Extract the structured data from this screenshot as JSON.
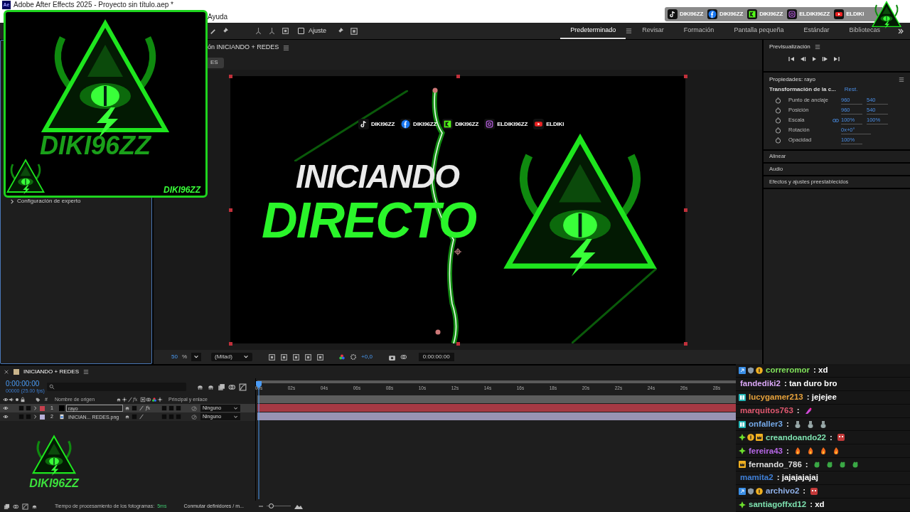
{
  "window": {
    "app_icon": "Ae",
    "title": "Adobe After Effects 2025 - Proyecto sin título.aep *"
  },
  "menu": [
    "Ayuda"
  ],
  "toolbar": {
    "snap": {
      "label": "Ajuste",
      "checked": false
    }
  },
  "workspaces": [
    {
      "label": "Predeterminado",
      "selected": true
    },
    {
      "label": "Revisar",
      "selected": false
    },
    {
      "label": "Formación",
      "selected": false
    },
    {
      "label": "Pantalla pequeña",
      "selected": false
    },
    {
      "label": "Estándar",
      "selected": false
    },
    {
      "label": "Bibliotecas",
      "selected": false
    }
  ],
  "project_panel": {
    "items": [
      {
        "label": "Configuración de experto",
        "expanded": false
      }
    ]
  },
  "composition": {
    "tab": "ón INICIANDO + REDES",
    "breadcrumb": "ES",
    "frame": {
      "socials": [
        {
          "kind": "tiktok",
          "label": "DIKI96ZZ"
        },
        {
          "kind": "facebook",
          "label": "DIKI96ZZ"
        },
        {
          "kind": "kick",
          "label": "DIKI96ZZ"
        },
        {
          "kind": "instagram",
          "label": "ELDIKI96ZZ"
        },
        {
          "kind": "youtube",
          "label": "ELDIKI"
        }
      ],
      "title_line_1": "INICIANDO",
      "title_line_2": "DIRECTO"
    },
    "viewer_bar": {
      "zoom": "50",
      "zoom_unit": "%",
      "resolution": "(Mitad)",
      "exposure": "+0,0",
      "timecode": "0:00:00:00"
    }
  },
  "preview": {
    "title": "Previsualización"
  },
  "properties": {
    "title": "Propiedades: rayo",
    "group": "Transformación de la c...",
    "reset": "Rest.",
    "rows": [
      {
        "label": "Punto de anclaje",
        "values": [
          "960",
          "540"
        ],
        "linked": false
      },
      {
        "label": "Posición",
        "values": [
          "960",
          "540"
        ],
        "linked": false
      },
      {
        "label": "Escala",
        "values": [
          "100%",
          "100%"
        ],
        "linked": true
      },
      {
        "label": "Rotación",
        "values": [
          "0x+0°"
        ],
        "linked": false
      },
      {
        "label": "Opacidad",
        "values": [
          "100%"
        ],
        "linked": false
      }
    ]
  },
  "panels": [
    "Alinear",
    "Audio",
    "Efectos y ajustes preestablecidos"
  ],
  "timeline": {
    "tab": "INICIANDO + REDES",
    "timecode": "0:00:00:00",
    "fps": "00000 (25.00 fps)",
    "columns": {
      "number": "#",
      "name": "Nombre de origen",
      "fx": "fx",
      "parent": "Principal y enlace"
    },
    "layers": [
      {
        "number": "1",
        "kind": "solid",
        "name": "rayo",
        "color": "#c8404e",
        "selected": true,
        "fx": "fx",
        "parent": "Ninguno"
      },
      {
        "number": "2",
        "kind": "image",
        "name": "INICIAN... REDES.png",
        "color": "#b7b0d8",
        "selected": false,
        "parent": "Ninguno"
      }
    ],
    "ruler": [
      "00s",
      "02s",
      "04s",
      "06s",
      "08s",
      "10s",
      "12s",
      "14s",
      "16s",
      "18s",
      "20s",
      "22s",
      "24s",
      "26s",
      "28s"
    ],
    "status": {
      "label": "Tiempo de procesamiento de los fotogramas:",
      "value": "5ms",
      "toggle": "Conmutar definidores / m...",
      "zoom_slider": {
        "level": 0.1
      }
    }
  },
  "logo_overlay": {
    "title": "DIKI96ZZ",
    "tag": "DIKI96ZZ"
  },
  "corner_logo": {
    "title": "DIKI96ZZ"
  },
  "social_bar": [
    {
      "kind": "tiktok",
      "label": "DIKI96ZZ"
    },
    {
      "kind": "facebook",
      "label": "DIKI96ZZ"
    },
    {
      "kind": "kick",
      "label": "DIKI96ZZ"
    },
    {
      "kind": "instagram",
      "label": "ELDIKI96ZZ"
    },
    {
      "kind": "youtube",
      "label": "ELDIKI"
    }
  ],
  "chat": [
    {
      "badges": [
        {
          "kind": "prime"
        },
        {
          "kind": "gem"
        },
        {
          "kind": "coin"
        }
      ],
      "user": "correromor",
      "color": "#7fe05a",
      "text": ": xd"
    },
    {
      "user": "fandediki2",
      "color": "#d9a6f5",
      "text": ": tan duro bro"
    },
    {
      "badges": [
        {
          "kind": "gg"
        }
      ],
      "user": "lucygamer213",
      "color": "#e8a33c",
      "text": ": jejejee"
    },
    {
      "user": "marquitos763",
      "color": "#e0586f",
      "text": ":",
      "emotes": [
        {
          "kind": "sparkle"
        }
      ]
    },
    {
      "badges": [
        {
          "kind": "gg"
        }
      ],
      "user": "onfaller3",
      "color": "#74a9e8",
      "text": ":",
      "emotes": [
        {
          "kind": "rabbit"
        },
        {
          "kind": "rabbit"
        },
        {
          "kind": "rabbit"
        }
      ]
    },
    {
      "badges": [
        {
          "kind": "star"
        },
        {
          "kind": "coin"
        },
        {
          "kind": "crown"
        }
      ],
      "user": "creandoando22",
      "color": "#7ee2b0",
      "text": ":",
      "emotes": [
        {
          "kind": "face"
        }
      ]
    },
    {
      "badges": [
        {
          "kind": "star"
        }
      ],
      "user": "fereira43",
      "color": "#b667e6",
      "text": ":",
      "emotes": [
        {
          "kind": "fire"
        },
        {
          "kind": "fire"
        },
        {
          "kind": "fire"
        },
        {
          "kind": "fire"
        }
      ]
    },
    {
      "badges": [
        {
          "kind": "crown"
        }
      ],
      "user": "fernando_786",
      "color": "#dddddd",
      "text": ":",
      "emotes": [
        {
          "kind": "frog"
        },
        {
          "kind": "frog"
        },
        {
          "kind": "frog"
        },
        {
          "kind": "frog"
        }
      ]
    },
    {
      "user": "mamita2",
      "color": "#3f7fd6",
      "text": ": jajajajajaj"
    },
    {
      "badges": [
        {
          "kind": "prime"
        },
        {
          "kind": "gem"
        },
        {
          "kind": "coin"
        }
      ],
      "user": "archivo2",
      "color": "#8fb0e8",
      "text": ":",
      "emotes": [
        {
          "kind": "face"
        }
      ]
    },
    {
      "badges": [
        {
          "kind": "star"
        }
      ],
      "user": "santiagoffxd12",
      "color": "#7ee2b0",
      "text": ": xd"
    }
  ]
}
